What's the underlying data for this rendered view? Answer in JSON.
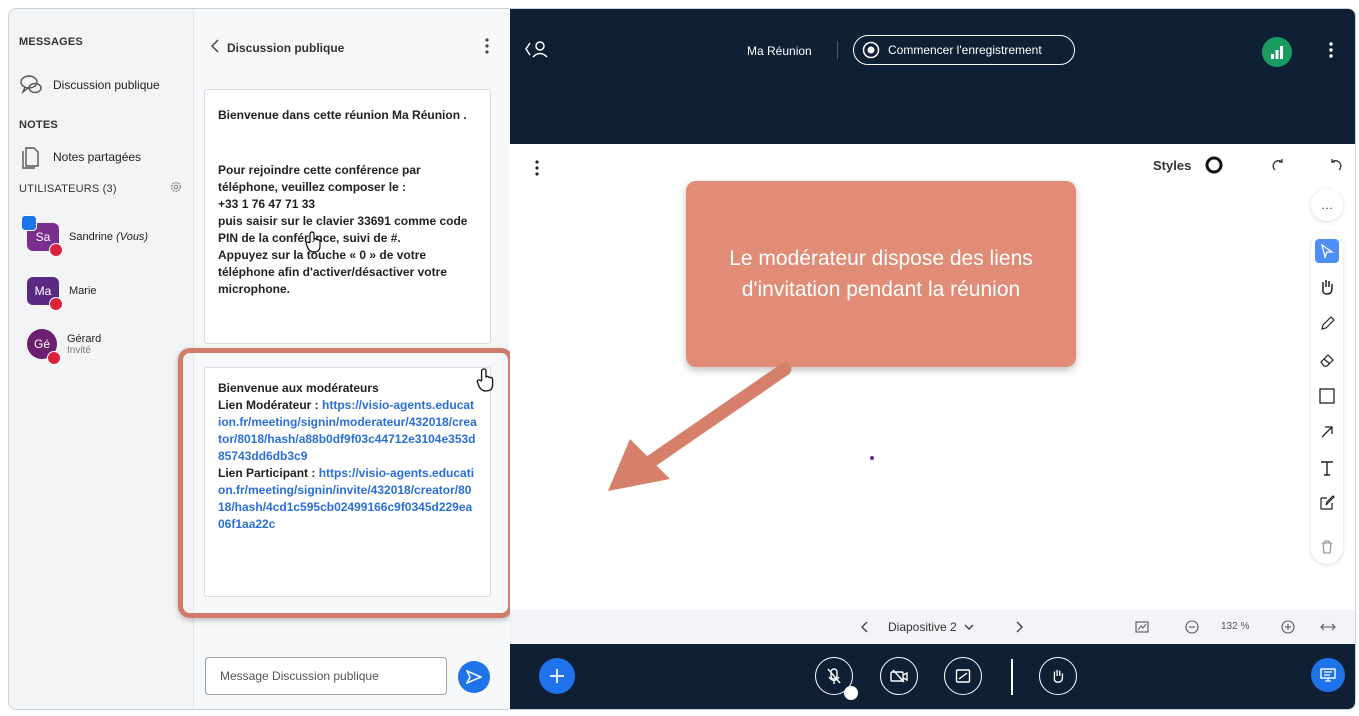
{
  "sidebar": {
    "messages_title": "MESSAGES",
    "public_chat_label": "Discussion publique",
    "notes_title": "NOTES",
    "shared_notes_label": "Notes partagées",
    "users_title": "UTILISATEURS (3)",
    "users": [
      {
        "initials": "Sa",
        "name": "Sandrine",
        "suffix": "(Vous)",
        "color": "#7b2d8e"
      },
      {
        "initials": "Ma",
        "name": "Marie",
        "suffix": "",
        "color": "#5a2a82"
      },
      {
        "initials": "Gé",
        "name": "Gérard",
        "suffix": "Invité",
        "color": "#6b1f6e"
      }
    ]
  },
  "chat": {
    "title": "Discussion publique",
    "welcome": "Bienvenue dans cette réunion Ma Réunion .",
    "phone_intro": "Pour rejoindre cette conférence par téléphone, veuillez composer le :",
    "phone_number": "+33 1 76 47 71 33",
    "phone_pin": "puis saisir sur le clavier 33691 comme code PIN de la conférence, suivi de #.",
    "phone_mute": "Appuyez sur la touche « 0 » de votre téléphone afin d'activer/désactiver votre microphone.",
    "moderators_title": "Bienvenue aux modérateurs",
    "moderator_link_label": "Lien Modérateur  : ",
    "moderator_link": "https://visio-agents.education.fr/meeting/signin/moderateur/432018/creator/8018/hash/a88b0df9f03c44712e3104e353d85743dd6db3c9",
    "participant_link_label": "Lien Participant  : ",
    "participant_link": "https://visio-agents.education.fr/meeting/signin/invite/432018/creator/8018/hash/4cd1c595cb02499166c9f0345d229ea06f1aa22c",
    "input_placeholder": "Message Discussion publique"
  },
  "topbar": {
    "meeting_name": "Ma Réunion",
    "record_label": "Commencer l'enregistrement"
  },
  "whiteboard": {
    "styles_label": "Styles",
    "more_label": "…",
    "callout_text": "Le modérateur dispose des liens d'invitation pendant la réunion",
    "accent_color": "#e08c76"
  },
  "slidebar": {
    "slide_label": "Diapositive 2",
    "zoom_label": "132 %"
  },
  "colors": {
    "navy": "#0f1f34",
    "blue": "#1e73e8",
    "green": "#1c9b60",
    "mute_red": "#d9223c"
  }
}
